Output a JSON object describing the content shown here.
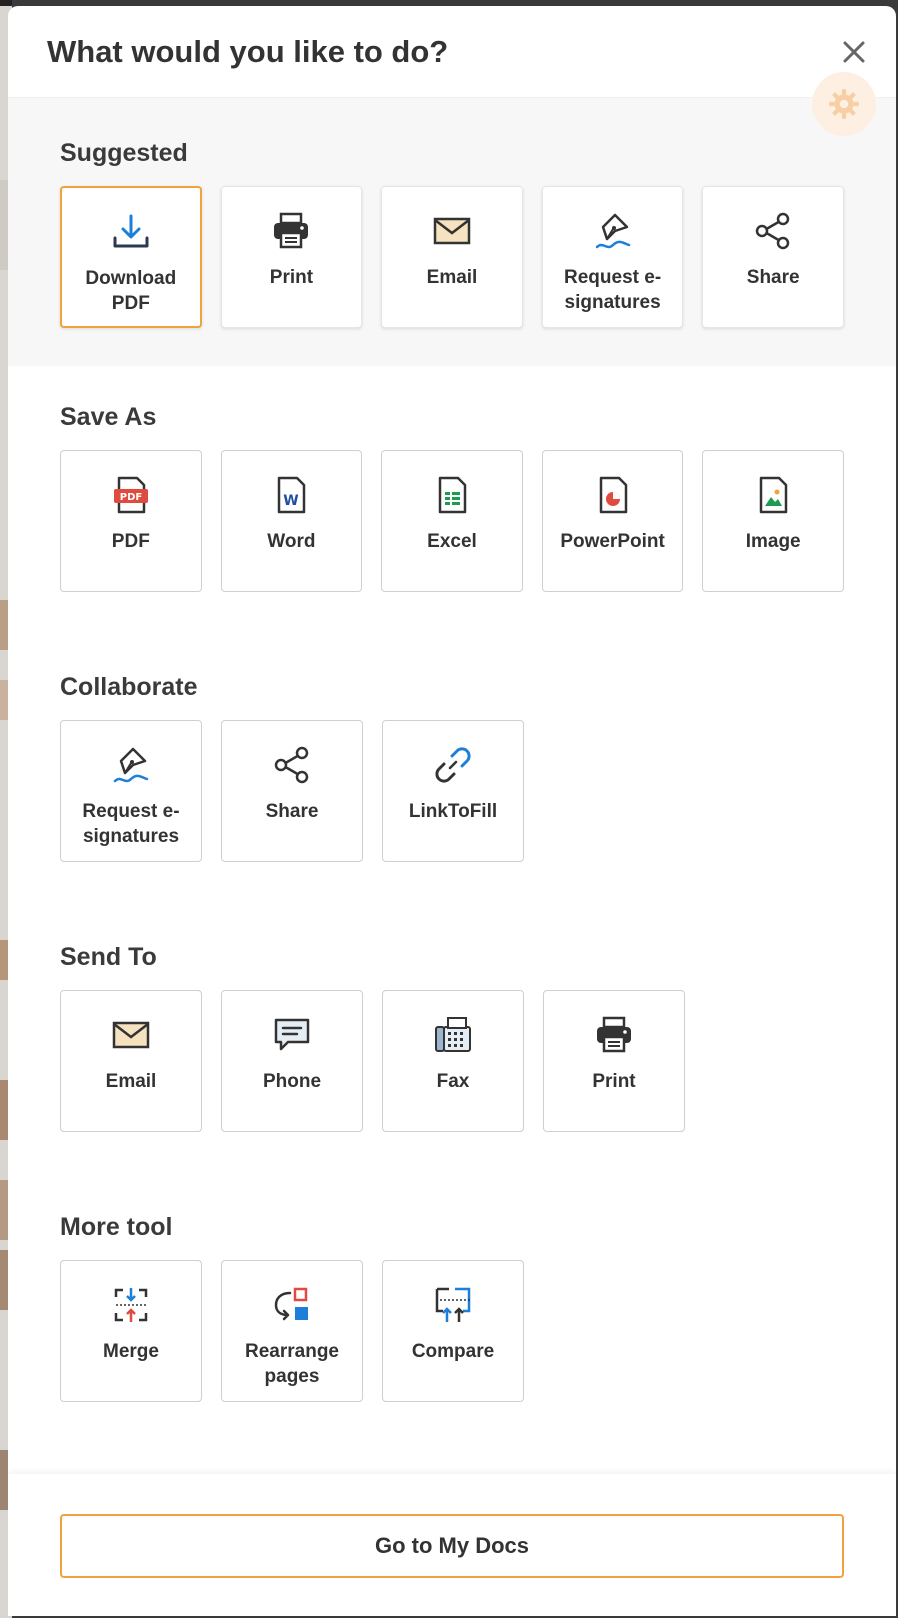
{
  "modal": {
    "title": "What would you like to do?"
  },
  "sections": {
    "suggested": {
      "title": "Suggested",
      "items": [
        "Download PDF",
        "Print",
        "Email",
        "Request e-signatures",
        "Share"
      ]
    },
    "save_as": {
      "title": "Save As",
      "items": [
        "PDF",
        "Word",
        "Excel",
        "PowerPoint",
        "Image"
      ]
    },
    "collaborate": {
      "title": "Collaborate",
      "items": [
        "Request e-signatures",
        "Share",
        "LinkToFill"
      ]
    },
    "send_to": {
      "title": "Send To",
      "items": [
        "Email",
        "Phone",
        "Fax",
        "Print"
      ]
    },
    "more_tool": {
      "title": "More tool",
      "items": [
        "Merge",
        "Rearrange pages",
        "Compare"
      ]
    }
  },
  "footer": {
    "go_label": "Go to My Docs"
  },
  "colors": {
    "accent": "#f0a23b",
    "blue": "#1e7fd8",
    "red": "#e04b3f",
    "green": "#1f9a52"
  }
}
